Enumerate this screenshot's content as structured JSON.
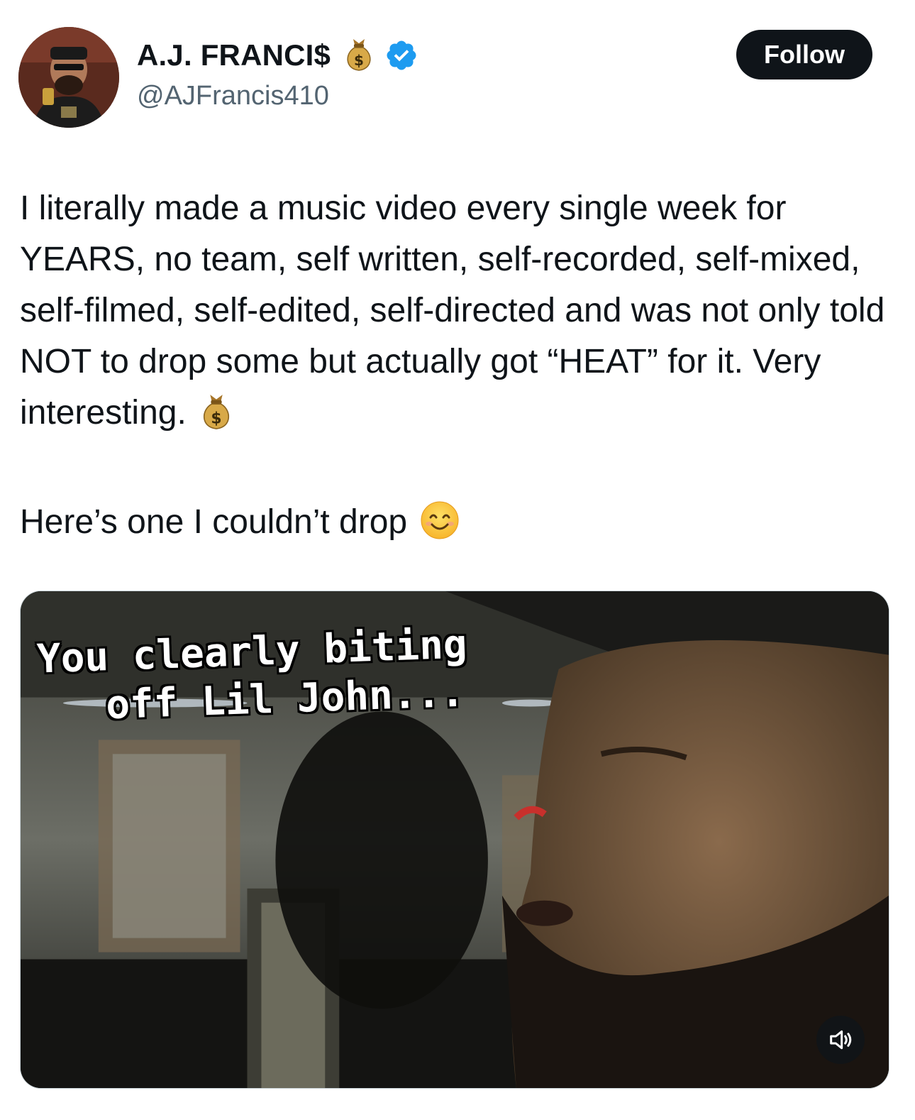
{
  "author": {
    "display_name": "A.J. FRANCI$",
    "name_emoji": "money-bag-icon",
    "verified": true,
    "handle": "@AJFrancis410"
  },
  "follow_button": {
    "label": "Follow"
  },
  "tweet": {
    "paragraph1": "I literally made a music video every single week for YEARS, no team, self written, self-recorded, self-mixed, self-filmed, self-edited, self-directed and was not only told NOT to drop some but actually got “HEAT” for it. Very interesting.",
    "paragraph1_emoji": "money-bag-icon",
    "paragraph2": "Here’s one I couldn’t drop",
    "paragraph2_emoji": "smiling-face-icon"
  },
  "media": {
    "type": "video",
    "caption_line1": "You clearly biting",
    "caption_line2": "off Lil John...",
    "controls": {
      "mute_icon": "speaker-muted-icon"
    }
  },
  "colors": {
    "text": "#0f1419",
    "secondary_text": "#536471",
    "verified_blue": "#1d9bf0",
    "follow_bg": "#0f1419",
    "follow_text": "#ffffff"
  }
}
